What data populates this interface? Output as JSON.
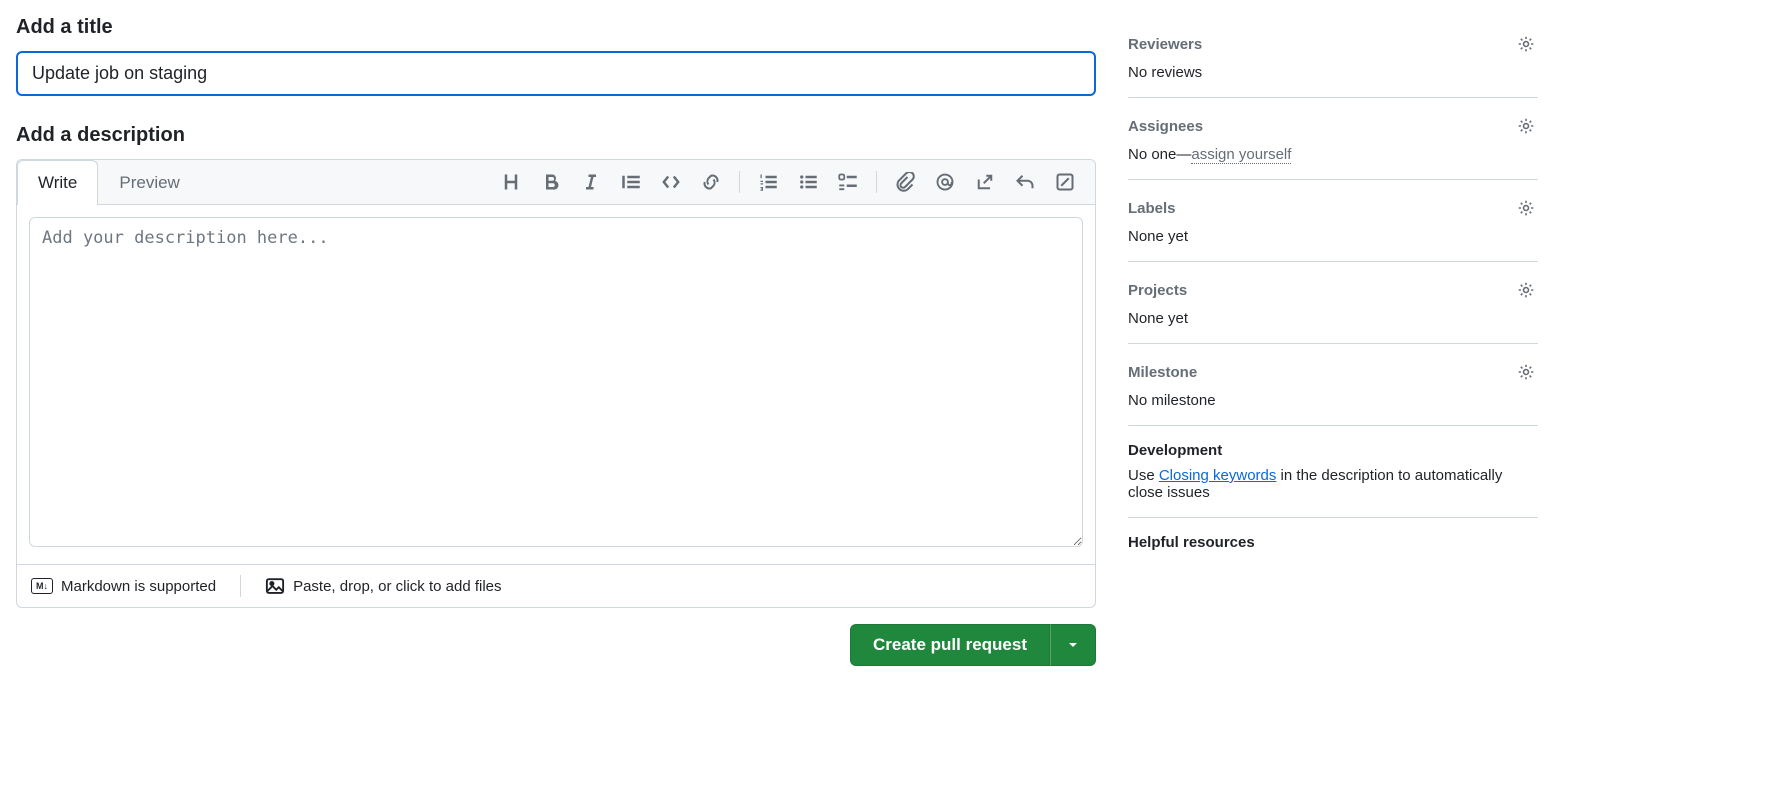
{
  "title_section": {
    "label": "Add a title",
    "value": "Update job on staging"
  },
  "description_section": {
    "label": "Add a description",
    "tabs": {
      "write": "Write",
      "preview": "Preview"
    },
    "placeholder": "Add your description here...",
    "footer": {
      "markdown": "Markdown is supported",
      "attach": "Paste, drop, or click to add files"
    }
  },
  "actions": {
    "create": "Create pull request"
  },
  "sidebar": {
    "reviewers": {
      "title": "Reviewers",
      "body": "No reviews"
    },
    "assignees": {
      "title": "Assignees",
      "body_prefix": "No one—",
      "assign_self": "assign yourself"
    },
    "labels": {
      "title": "Labels",
      "body": "None yet"
    },
    "projects": {
      "title": "Projects",
      "body": "None yet"
    },
    "milestone": {
      "title": "Milestone",
      "body": "No milestone"
    },
    "development": {
      "title": "Development",
      "prefix": "Use ",
      "link": "Closing keywords",
      "suffix": " in the description to automatically close issues"
    },
    "helpful": {
      "title": "Helpful resources"
    }
  }
}
